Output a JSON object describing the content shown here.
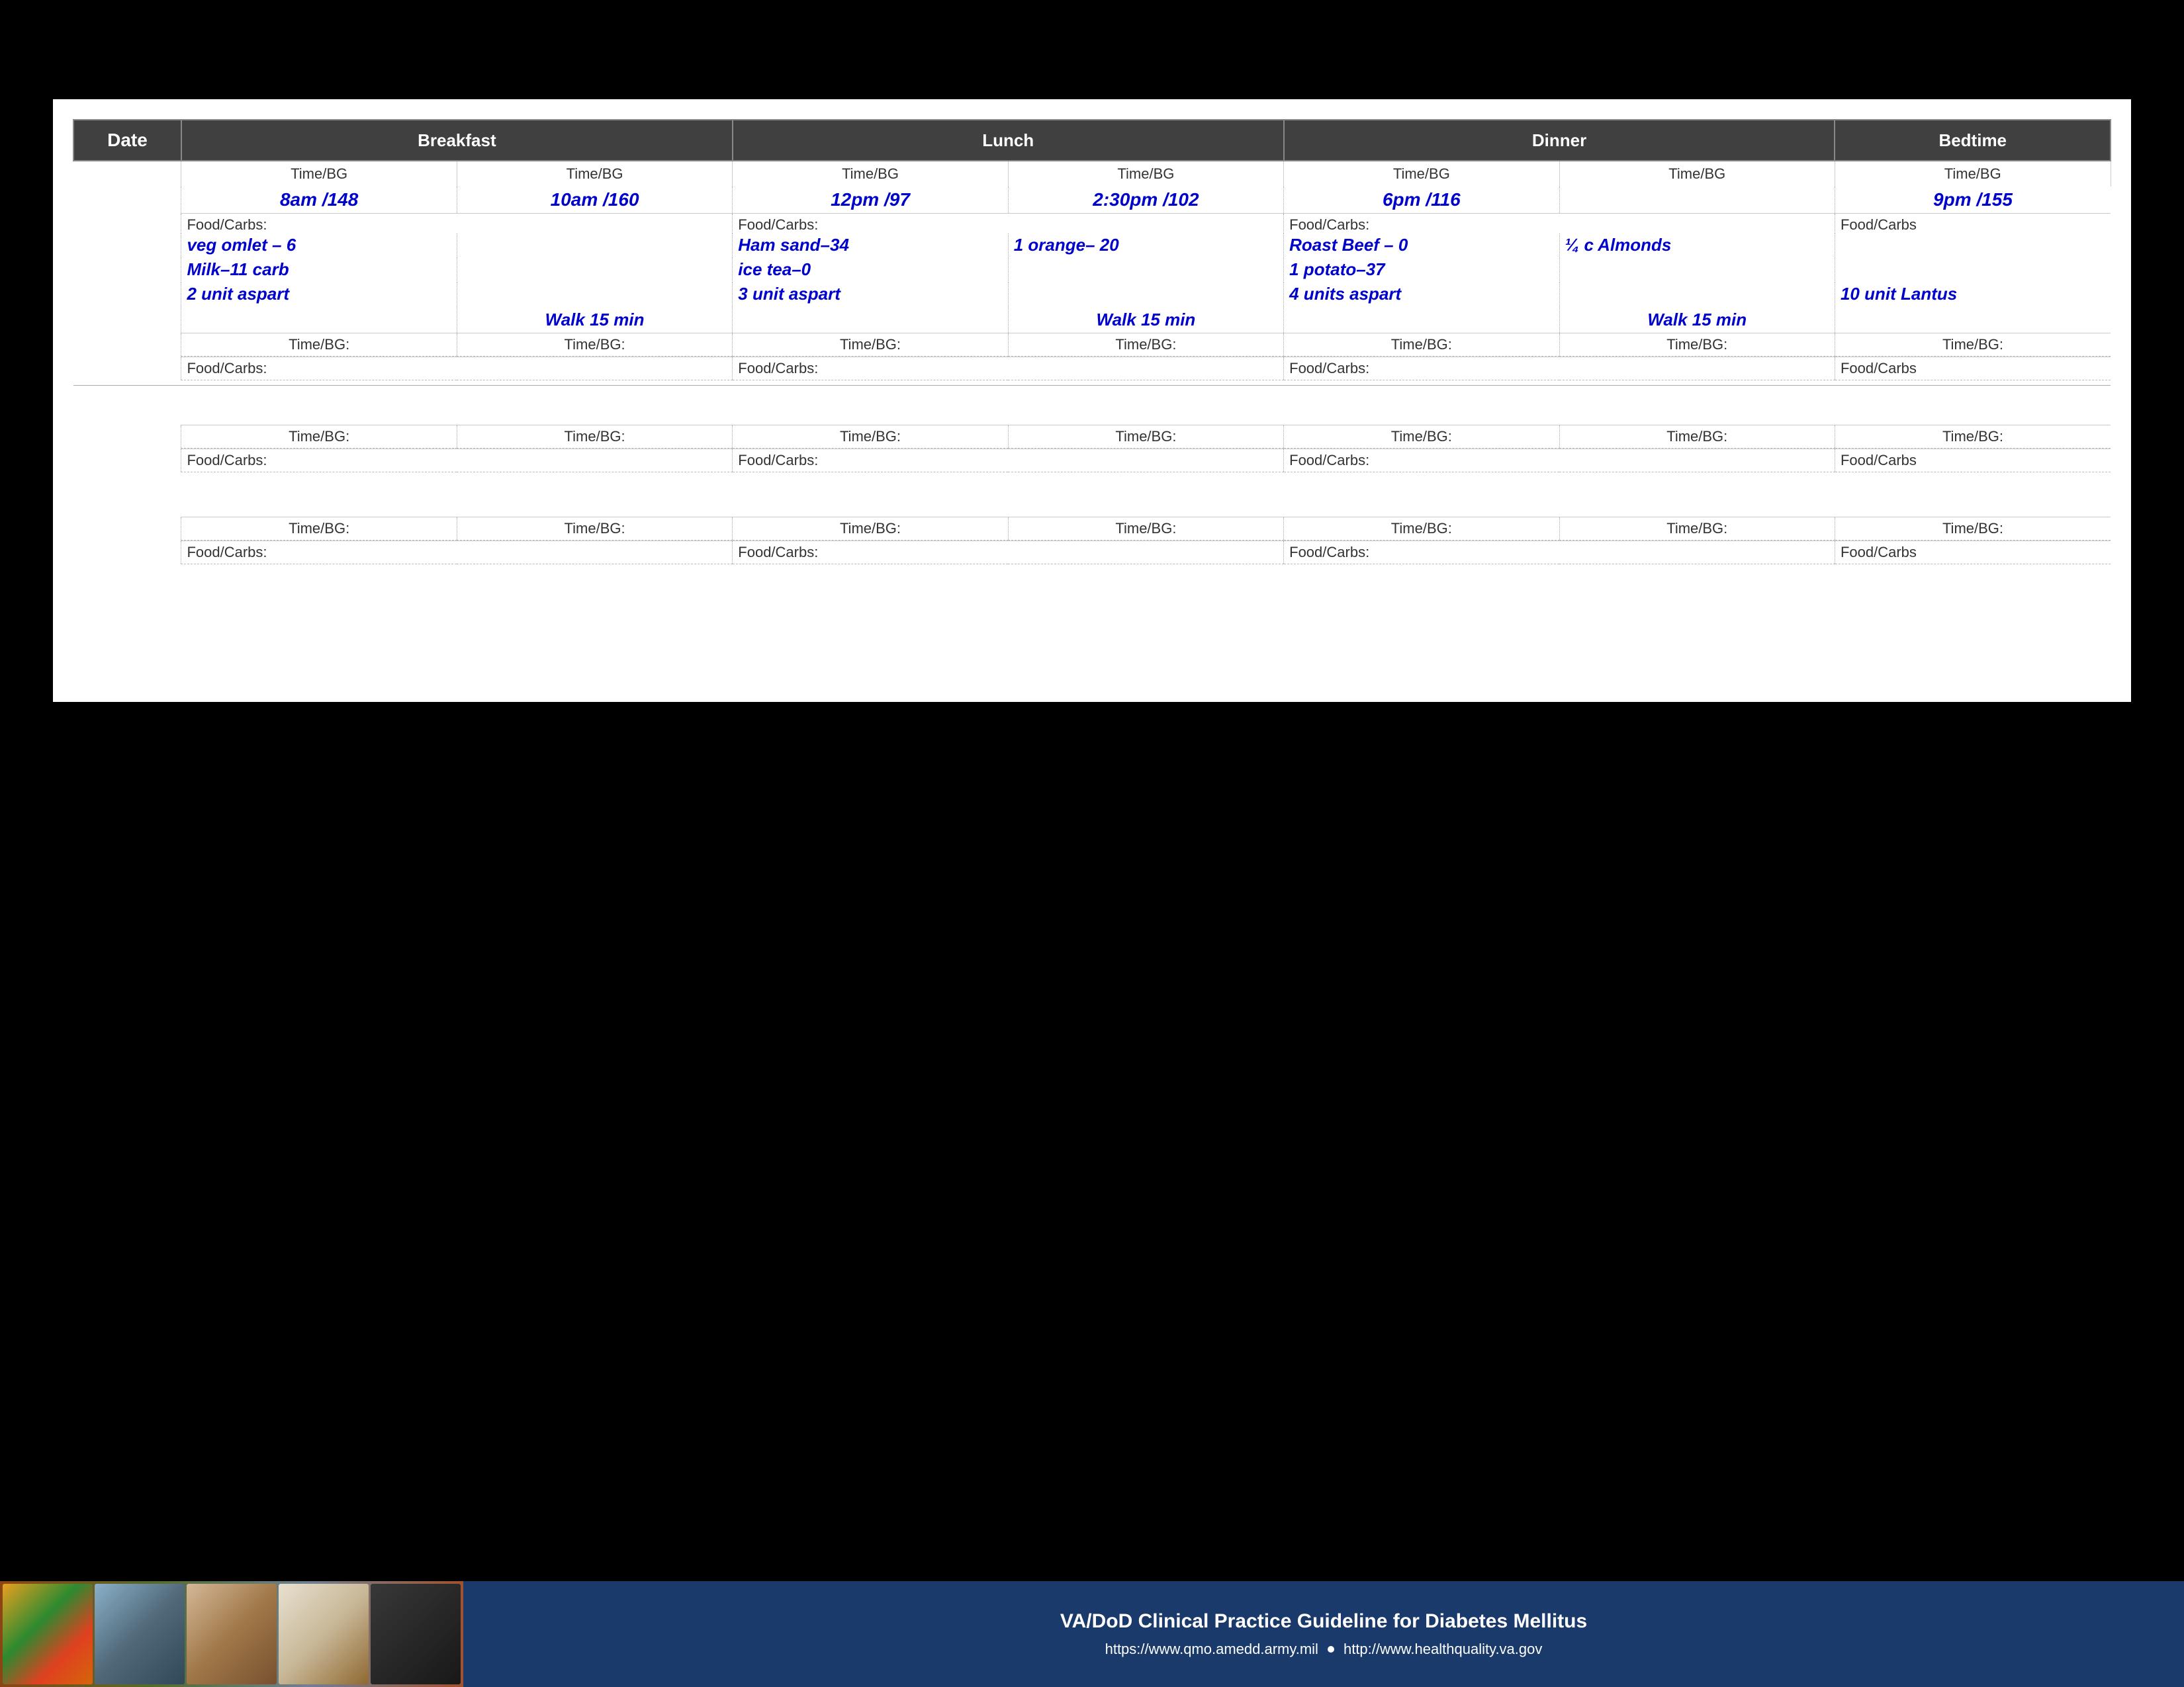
{
  "header": {
    "date_label": "Date",
    "breakfast_label": "Breakfast",
    "lunch_label": "Lunch",
    "dinner_label": "Dinner",
    "bedtime_label": "Bedtime"
  },
  "subheader": {
    "timebg": "Time/BG"
  },
  "row1": {
    "time_bf1": "8am /148",
    "time_bf2": "10am /160",
    "time_lu1": "12pm /97",
    "time_lu2": "2:30pm /102",
    "time_di1": "6pm /116",
    "time_di2": "",
    "time_bt": "9pm /155",
    "food_label": "Food/Carbs:",
    "food_bf1": "veg omlet – 6",
    "food_bf2": "",
    "food_lu1": "Ham sand–34",
    "food_lu2": "1 orange– 20",
    "food_di1": "Roast Beef – 0",
    "food_di2": "¼ c Almonds",
    "food_bt": "",
    "food2_bf1": "Milk–11 carb",
    "food2_bf2": "",
    "food2_lu1": "ice tea–0",
    "food2_lu2": "",
    "food2_di1": "1 potato–37",
    "food2_di2": "",
    "food2_bt": "",
    "insulin_bf1": "2 unit aspart",
    "insulin_bf2": "",
    "insulin_lu1": "3 unit aspart",
    "insulin_lu2": "",
    "insulin_di1": "4 units aspart",
    "insulin_di2": "",
    "insulin_bt": "10 unit Lantus",
    "exercise_bf2": "Walk 15 min",
    "exercise_lu2": "Walk 15 min",
    "exercise_di2": "Walk 15 min"
  },
  "empty_rows": {
    "timebg_label": "Time/BG:",
    "food_label": "Food/Carbs:",
    "food_carbs_label": "Food/Carbs"
  },
  "footer": {
    "title": "VA/DoD Clinical Practice Guideline for Diabetes Mellitus",
    "url1": "https://www.qmo.amedd.army.mil",
    "url2": "http://www.healthquality.va.gov"
  },
  "colors": {
    "header_bg": "#404040",
    "header_text": "#ffffff",
    "blue_text": "#0000cc",
    "footer_bg": "#1a3a6b"
  }
}
